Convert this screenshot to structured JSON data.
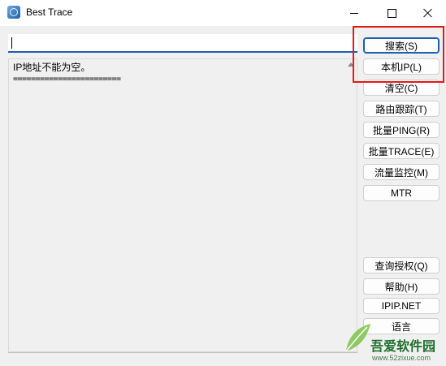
{
  "window": {
    "title": "Best Trace",
    "icon": "globe-app-icon"
  },
  "search": {
    "value": "",
    "placeholder": ""
  },
  "results": {
    "message": "IP地址不能为空。",
    "separator": "========================"
  },
  "buttons": {
    "search": "搜索(S)",
    "local_ip": "本机IP(L)",
    "clear": "清空(C)",
    "route_trace": "路由跟踪(T)",
    "batch_ping": "批量PING(R)",
    "batch_trace": "批量TRACE(E)",
    "traffic_monitor": "流量监控(M)",
    "mtr": "MTR",
    "query_license": "查询授权(Q)",
    "help": "帮助(H)",
    "ipip": "IPIP.NET",
    "language": "语言"
  },
  "watermark": {
    "site_name": "吾爱软件园",
    "url": "www.52zixue.com"
  },
  "colors": {
    "highlight": "#e21a1a",
    "accent": "#1a5fb4"
  }
}
